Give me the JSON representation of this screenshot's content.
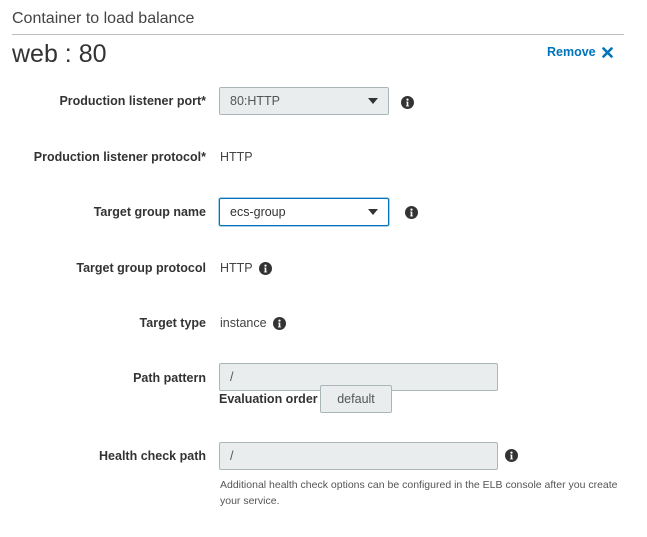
{
  "section": {
    "title": "Container to load balance"
  },
  "container": {
    "heading": "web : 80",
    "remove_label": "Remove"
  },
  "fields": {
    "production_listener_port": {
      "label": "Production listener port*",
      "selected": "80:HTTP"
    },
    "production_listener_protocol": {
      "label": "Production listener protocol*",
      "value": "HTTP"
    },
    "target_group_name": {
      "label": "Target group name",
      "selected": "ecs-group"
    },
    "target_group_protocol": {
      "label": "Target group protocol",
      "value": "HTTP"
    },
    "target_type": {
      "label": "Target type",
      "value": "instance"
    },
    "path_pattern": {
      "label": "Path pattern",
      "value": "/"
    },
    "evaluation_order": {
      "label": "Evaluation order",
      "value": "default"
    },
    "health_check_path": {
      "label": "Health check path",
      "value": "/",
      "help": "Additional health check options can be configured in the ELB console after you create your service."
    }
  },
  "icons": {
    "info": "info-icon",
    "close": "close-icon",
    "dropdown": "chevron-down-icon"
  },
  "colors": {
    "link": "#0073bb",
    "focus_border": "#0073bb",
    "disabled_bg": "#eaeded",
    "border": "#aab7b8"
  }
}
